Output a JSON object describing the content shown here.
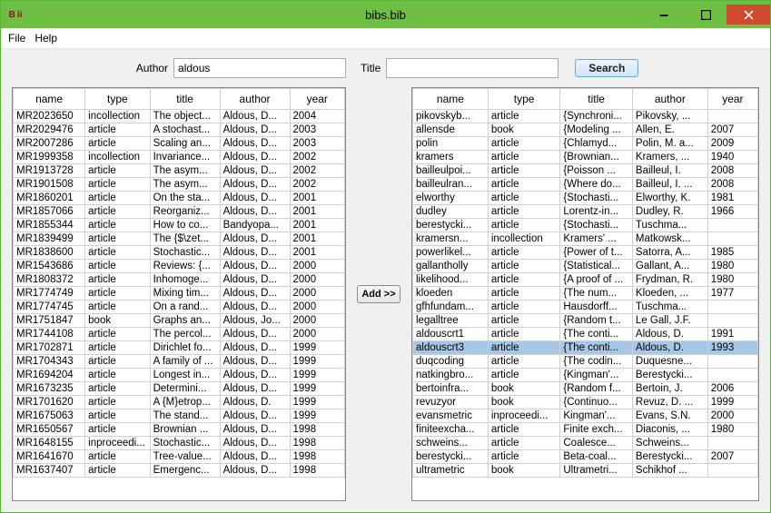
{
  "window": {
    "title": "bibs.bib"
  },
  "menu": {
    "file": "File",
    "help": "Help"
  },
  "search": {
    "author_label": "Author",
    "author_value": "aldous",
    "title_label": "Title",
    "title_value": "",
    "button": "Search"
  },
  "add_button": "Add >>",
  "columns": {
    "name": "name",
    "type": "type",
    "title": "title",
    "author": "author",
    "year": "year"
  },
  "left_rows": [
    {
      "name": "MR2023650",
      "type": "incollection",
      "title": "The object...",
      "author": "Aldous, D...",
      "year": "2004"
    },
    {
      "name": "MR2029476",
      "type": "article",
      "title": "A stochast...",
      "author": "Aldous, D...",
      "year": "2003"
    },
    {
      "name": "MR2007286",
      "type": "article",
      "title": "Scaling an...",
      "author": "Aldous, D...",
      "year": "2003"
    },
    {
      "name": "MR1999358",
      "type": "incollection",
      "title": "Invariance...",
      "author": "Aldous, D...",
      "year": "2002"
    },
    {
      "name": "MR1913728",
      "type": "article",
      "title": "The asym...",
      "author": "Aldous, D...",
      "year": "2002"
    },
    {
      "name": "MR1901508",
      "type": "article",
      "title": "The asym...",
      "author": "Aldous, D...",
      "year": "2002"
    },
    {
      "name": "MR1860201",
      "type": "article",
      "title": "On the sta...",
      "author": "Aldous, D...",
      "year": "2001"
    },
    {
      "name": "MR1857066",
      "type": "article",
      "title": "Reorganiz...",
      "author": "Aldous, D...",
      "year": "2001"
    },
    {
      "name": "MR1855344",
      "type": "article",
      "title": "How to co...",
      "author": "Bandyopa...",
      "year": "2001"
    },
    {
      "name": "MR1839499",
      "type": "article",
      "title": "The {$\\zet...",
      "author": "Aldous, D...",
      "year": "2001"
    },
    {
      "name": "MR1838600",
      "type": "article",
      "title": "Stochastic...",
      "author": "Aldous, D...",
      "year": "2001"
    },
    {
      "name": "MR1543686",
      "type": "article",
      "title": "Reviews: {...",
      "author": "Aldous, D...",
      "year": "2000"
    },
    {
      "name": "MR1808372",
      "type": "article",
      "title": "Inhomoge...",
      "author": "Aldous, D...",
      "year": "2000"
    },
    {
      "name": "MR1774749",
      "type": "article",
      "title": "Mixing tim...",
      "author": "Aldous, D...",
      "year": "2000"
    },
    {
      "name": "MR1774745",
      "type": "article",
      "title": "On a rand...",
      "author": "Aldous, D...",
      "year": "2000"
    },
    {
      "name": "MR1751847",
      "type": "book",
      "title": "Graphs an...",
      "author": "Aldous, Jo...",
      "year": "2000"
    },
    {
      "name": "MR1744108",
      "type": "article",
      "title": "The percol...",
      "author": "Aldous, D...",
      "year": "2000"
    },
    {
      "name": "MR1702871",
      "type": "article",
      "title": "Dirichlet fo...",
      "author": "Aldous, D...",
      "year": "1999"
    },
    {
      "name": "MR1704343",
      "type": "article",
      "title": "A family of ...",
      "author": "Aldous, D...",
      "year": "1999"
    },
    {
      "name": "MR1694204",
      "type": "article",
      "title": "Longest in...",
      "author": "Aldous, D...",
      "year": "1999"
    },
    {
      "name": "MR1673235",
      "type": "article",
      "title": "Determini...",
      "author": "Aldous, D...",
      "year": "1999"
    },
    {
      "name": "MR1701620",
      "type": "article",
      "title": "A {M}etrop...",
      "author": "Aldous, D.",
      "year": "1999"
    },
    {
      "name": "MR1675063",
      "type": "article",
      "title": "The stand...",
      "author": "Aldous, D...",
      "year": "1999"
    },
    {
      "name": "MR1650567",
      "type": "article",
      "title": "Brownian ...",
      "author": "Aldous, D...",
      "year": "1998"
    },
    {
      "name": "MR1648155",
      "type": "inproceedi...",
      "title": "Stochastic...",
      "author": "Aldous, D...",
      "year": "1998"
    },
    {
      "name": "MR1641670",
      "type": "article",
      "title": "Tree-value...",
      "author": "Aldous, D...",
      "year": "1998"
    },
    {
      "name": "MR1637407",
      "type": "article",
      "title": "Emergenc...",
      "author": "Aldous, D...",
      "year": "1998"
    }
  ],
  "right_rows": [
    {
      "name": "pikovskyb...",
      "type": "article",
      "title": "{Synchroni...",
      "author": "Pikovsky, ...",
      "year": ""
    },
    {
      "name": "allensde",
      "type": "book",
      "title": "{Modeling ...",
      "author": "Allen, E.",
      "year": "2007"
    },
    {
      "name": "polin",
      "type": "article",
      "title": "{Chlamyd...",
      "author": "Polin, M. a...",
      "year": "2009"
    },
    {
      "name": "kramers",
      "type": "article",
      "title": "{Brownian...",
      "author": "Kramers, ...",
      "year": "1940"
    },
    {
      "name": "bailleulpoi...",
      "type": "article",
      "title": "{Poisson ...",
      "author": "Bailleul, I.",
      "year": "2008"
    },
    {
      "name": "bailleulran...",
      "type": "article",
      "title": "{Where do...",
      "author": "Bailleul, I. ...",
      "year": "2008"
    },
    {
      "name": "elworthy",
      "type": "article",
      "title": "{Stochasti...",
      "author": "Elworthy, K.",
      "year": "1981"
    },
    {
      "name": "dudley",
      "type": "article",
      "title": "Lorentz-in...",
      "author": "Dudley, R.",
      "year": "1966"
    },
    {
      "name": "berestycki...",
      "type": "article",
      "title": "{Stochasti...",
      "author": "Tuschma...",
      "year": ""
    },
    {
      "name": "kramersn...",
      "type": "incollection",
      "title": "Kramers' ...",
      "author": "Matkowsk...",
      "year": ""
    },
    {
      "name": "powerlikel...",
      "type": "article",
      "title": "{Power of t...",
      "author": "Satorra, A...",
      "year": "1985"
    },
    {
      "name": "gallantholly",
      "type": "article",
      "title": "{Statistical...",
      "author": "Gallant, A...",
      "year": "1980"
    },
    {
      "name": "likelihood...",
      "type": "article",
      "title": "{A proof of ...",
      "author": "Frydman, R.",
      "year": "1980"
    },
    {
      "name": "kloeden",
      "type": "article",
      "title": "{The num...",
      "author": "Kloeden, ...",
      "year": "1977"
    },
    {
      "name": "gfhfundam...",
      "type": "article",
      "title": "Hausdorff...",
      "author": "Tuschma...",
      "year": ""
    },
    {
      "name": "legalltree",
      "type": "article",
      "title": "{Random t...",
      "author": "Le Gall, J.F.",
      "year": ""
    },
    {
      "name": "aldouscrt1",
      "type": "article",
      "title": "{The conti...",
      "author": "Aldous, D.",
      "year": "1991"
    },
    {
      "name": "aldouscrt3",
      "type": "article",
      "title": "{The conti...",
      "author": "Aldous, D.",
      "year": "1993",
      "selected": true
    },
    {
      "name": "duqcoding",
      "type": "article",
      "title": "{The codin...",
      "author": "Duquesne...",
      "year": ""
    },
    {
      "name": "natkingbro...",
      "type": "article",
      "title": "{Kingman'...",
      "author": "Berestycki...",
      "year": ""
    },
    {
      "name": "bertoinfra...",
      "type": "book",
      "title": "{Random f...",
      "author": "Bertoin, J.",
      "year": "2006"
    },
    {
      "name": "revuzyor",
      "type": "book",
      "title": "{Continuo...",
      "author": "Revuz, D. ...",
      "year": "1999"
    },
    {
      "name": "evansmetric",
      "type": "inproceedi...",
      "title": "Kingman'...",
      "author": "Evans, S.N.",
      "year": "2000"
    },
    {
      "name": "finiteexcha...",
      "type": "article",
      "title": "Finite exch...",
      "author": "Diaconis, ...",
      "year": "1980"
    },
    {
      "name": "schweins...",
      "type": "article",
      "title": "Coalesce...",
      "author": "Schweins...",
      "year": ""
    },
    {
      "name": "berestycki...",
      "type": "article",
      "title": "Beta-coal...",
      "author": "Berestycki...",
      "year": "2007"
    },
    {
      "name": "ultrametric",
      "type": "book",
      "title": "Ultrametri...",
      "author": "Schikhof ...",
      "year": ""
    }
  ]
}
